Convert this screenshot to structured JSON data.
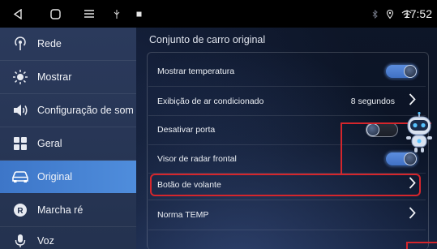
{
  "status_bar": {
    "time": "17:52",
    "nav_icons": [
      "back-icon",
      "home-icon",
      "menu-icon",
      "usb-icon",
      "notification-icon"
    ],
    "status_icons": [
      "bluetooth-icon",
      "location-icon",
      "wifi-icon"
    ]
  },
  "sidebar": {
    "items": [
      {
        "label": "Rede",
        "icon": "network-icon",
        "active": false
      },
      {
        "label": "Mostrar",
        "icon": "brightness-icon",
        "active": false
      },
      {
        "label": "Configuração de som",
        "icon": "volume-icon",
        "active": false
      },
      {
        "label": "Geral",
        "icon": "grid-icon",
        "active": false
      },
      {
        "label": "Original",
        "icon": "car-icon",
        "active": true
      },
      {
        "label": "Marcha ré",
        "icon": "reverse-gear-icon",
        "active": false
      },
      {
        "label": "Voz",
        "icon": "microphone-icon",
        "active": false
      }
    ]
  },
  "main": {
    "title": "Conjunto de carro original",
    "rows": [
      {
        "label": "Mostrar temperatura",
        "control": "toggle",
        "state": "on"
      },
      {
        "label": "Exibição de ar condicionado",
        "control": "chevron",
        "value": "8 segundos"
      },
      {
        "label": "Desativar porta",
        "control": "toggle",
        "state": "off"
      },
      {
        "label": "Visor de radar frontal",
        "control": "toggle",
        "state": "on"
      },
      {
        "label": "Botão de volante",
        "control": "chevron",
        "highlighted": true
      },
      {
        "label": "Norma TEMP",
        "control": "chevron"
      }
    ]
  },
  "colors": {
    "accent": "#4f8ddc",
    "sidebar_bg": "#2b3a5c",
    "highlight": "#d5262c",
    "toggle_on": "#5d8fe0"
  }
}
